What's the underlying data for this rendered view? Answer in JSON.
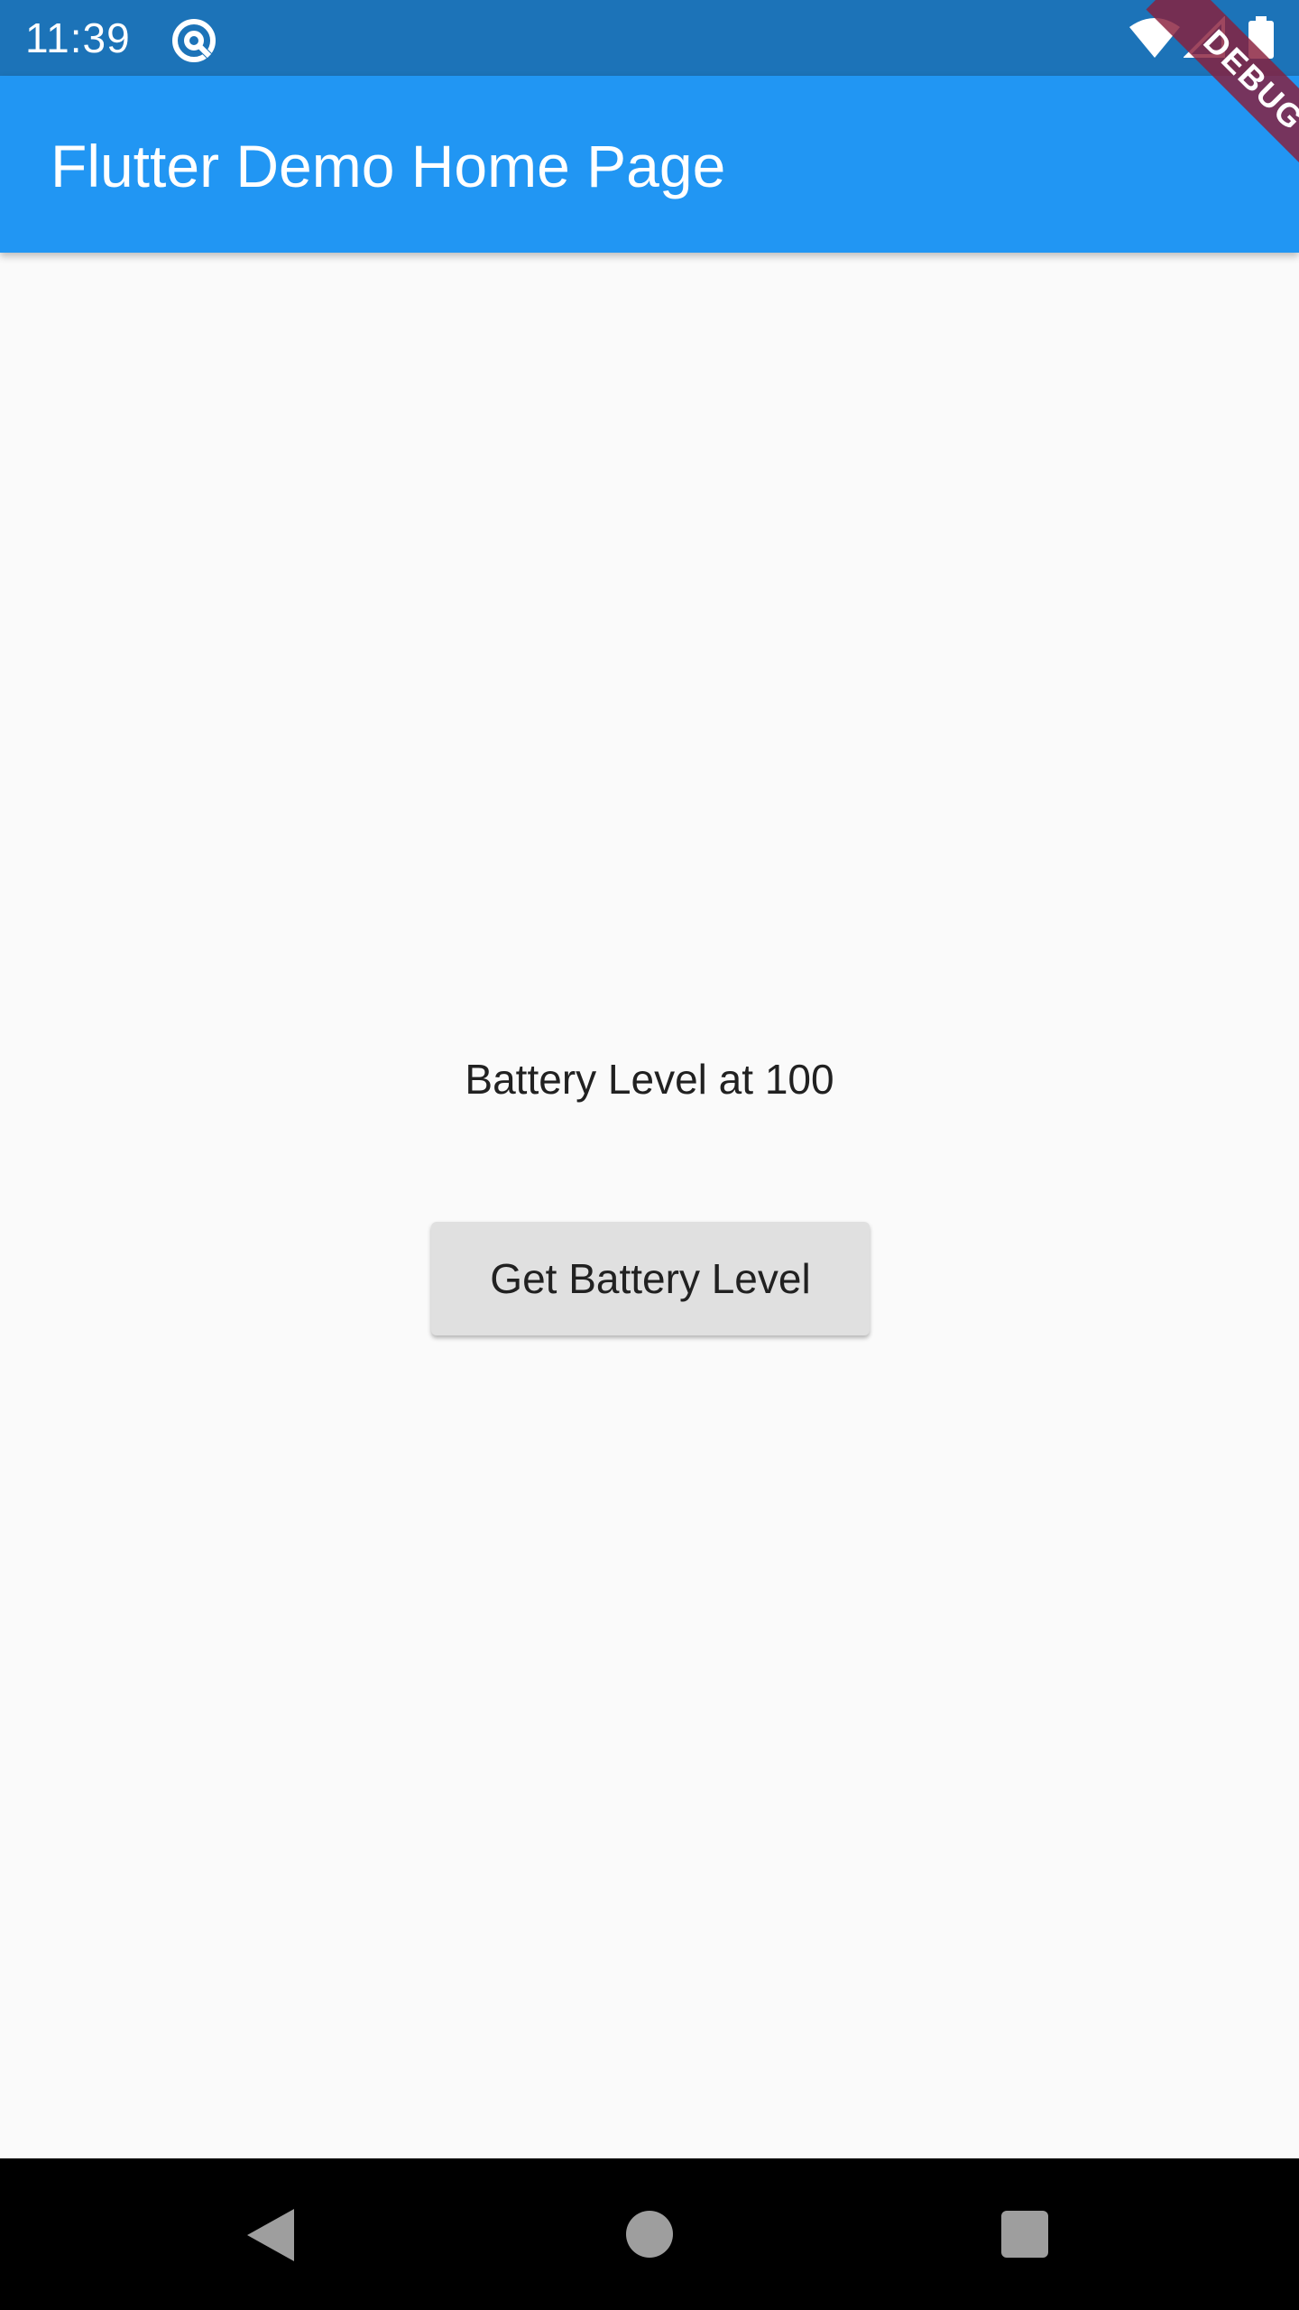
{
  "status_bar": {
    "time": "11:39",
    "notification_icon": "at-sign-icon",
    "wifi_icon": "wifi-icon",
    "signal_icon": "cell-signal-icon",
    "battery_icon": "battery-full-icon",
    "background_color": "#1c73b8"
  },
  "app_bar": {
    "title": "Flutter Demo Home Page",
    "background_color": "#2196f3"
  },
  "debug_banner": {
    "label": "DEBUG",
    "color": "#891f3c"
  },
  "main": {
    "battery_status": "Battery Level at 100",
    "get_battery_button_label": "Get Battery Level",
    "button_color": "#e0e0e0"
  },
  "nav_bar": {
    "back_icon": "back-triangle-icon",
    "home_icon": "home-circle-icon",
    "recents_icon": "recents-square-icon"
  }
}
